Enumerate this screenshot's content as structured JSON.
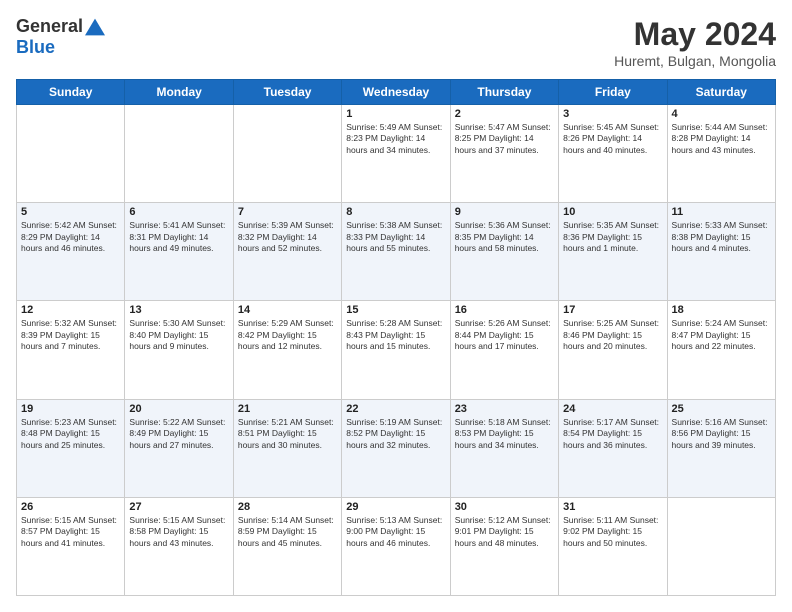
{
  "header": {
    "logo_line1": "General",
    "logo_line2": "Blue",
    "month": "May 2024",
    "location": "Huremt, Bulgan, Mongolia"
  },
  "days_of_week": [
    "Sunday",
    "Monday",
    "Tuesday",
    "Wednesday",
    "Thursday",
    "Friday",
    "Saturday"
  ],
  "weeks": [
    [
      {
        "day": "",
        "text": ""
      },
      {
        "day": "",
        "text": ""
      },
      {
        "day": "",
        "text": ""
      },
      {
        "day": "1",
        "text": "Sunrise: 5:49 AM\nSunset: 8:23 PM\nDaylight: 14 hours\nand 34 minutes."
      },
      {
        "day": "2",
        "text": "Sunrise: 5:47 AM\nSunset: 8:25 PM\nDaylight: 14 hours\nand 37 minutes."
      },
      {
        "day": "3",
        "text": "Sunrise: 5:45 AM\nSunset: 8:26 PM\nDaylight: 14 hours\nand 40 minutes."
      },
      {
        "day": "4",
        "text": "Sunrise: 5:44 AM\nSunset: 8:28 PM\nDaylight: 14 hours\nand 43 minutes."
      }
    ],
    [
      {
        "day": "5",
        "text": "Sunrise: 5:42 AM\nSunset: 8:29 PM\nDaylight: 14 hours\nand 46 minutes."
      },
      {
        "day": "6",
        "text": "Sunrise: 5:41 AM\nSunset: 8:31 PM\nDaylight: 14 hours\nand 49 minutes."
      },
      {
        "day": "7",
        "text": "Sunrise: 5:39 AM\nSunset: 8:32 PM\nDaylight: 14 hours\nand 52 minutes."
      },
      {
        "day": "8",
        "text": "Sunrise: 5:38 AM\nSunset: 8:33 PM\nDaylight: 14 hours\nand 55 minutes."
      },
      {
        "day": "9",
        "text": "Sunrise: 5:36 AM\nSunset: 8:35 PM\nDaylight: 14 hours\nand 58 minutes."
      },
      {
        "day": "10",
        "text": "Sunrise: 5:35 AM\nSunset: 8:36 PM\nDaylight: 15 hours\nand 1 minute."
      },
      {
        "day": "11",
        "text": "Sunrise: 5:33 AM\nSunset: 8:38 PM\nDaylight: 15 hours\nand 4 minutes."
      }
    ],
    [
      {
        "day": "12",
        "text": "Sunrise: 5:32 AM\nSunset: 8:39 PM\nDaylight: 15 hours\nand 7 minutes."
      },
      {
        "day": "13",
        "text": "Sunrise: 5:30 AM\nSunset: 8:40 PM\nDaylight: 15 hours\nand 9 minutes."
      },
      {
        "day": "14",
        "text": "Sunrise: 5:29 AM\nSunset: 8:42 PM\nDaylight: 15 hours\nand 12 minutes."
      },
      {
        "day": "15",
        "text": "Sunrise: 5:28 AM\nSunset: 8:43 PM\nDaylight: 15 hours\nand 15 minutes."
      },
      {
        "day": "16",
        "text": "Sunrise: 5:26 AM\nSunset: 8:44 PM\nDaylight: 15 hours\nand 17 minutes."
      },
      {
        "day": "17",
        "text": "Sunrise: 5:25 AM\nSunset: 8:46 PM\nDaylight: 15 hours\nand 20 minutes."
      },
      {
        "day": "18",
        "text": "Sunrise: 5:24 AM\nSunset: 8:47 PM\nDaylight: 15 hours\nand 22 minutes."
      }
    ],
    [
      {
        "day": "19",
        "text": "Sunrise: 5:23 AM\nSunset: 8:48 PM\nDaylight: 15 hours\nand 25 minutes."
      },
      {
        "day": "20",
        "text": "Sunrise: 5:22 AM\nSunset: 8:49 PM\nDaylight: 15 hours\nand 27 minutes."
      },
      {
        "day": "21",
        "text": "Sunrise: 5:21 AM\nSunset: 8:51 PM\nDaylight: 15 hours\nand 30 minutes."
      },
      {
        "day": "22",
        "text": "Sunrise: 5:19 AM\nSunset: 8:52 PM\nDaylight: 15 hours\nand 32 minutes."
      },
      {
        "day": "23",
        "text": "Sunrise: 5:18 AM\nSunset: 8:53 PM\nDaylight: 15 hours\nand 34 minutes."
      },
      {
        "day": "24",
        "text": "Sunrise: 5:17 AM\nSunset: 8:54 PM\nDaylight: 15 hours\nand 36 minutes."
      },
      {
        "day": "25",
        "text": "Sunrise: 5:16 AM\nSunset: 8:56 PM\nDaylight: 15 hours\nand 39 minutes."
      }
    ],
    [
      {
        "day": "26",
        "text": "Sunrise: 5:15 AM\nSunset: 8:57 PM\nDaylight: 15 hours\nand 41 minutes."
      },
      {
        "day": "27",
        "text": "Sunrise: 5:15 AM\nSunset: 8:58 PM\nDaylight: 15 hours\nand 43 minutes."
      },
      {
        "day": "28",
        "text": "Sunrise: 5:14 AM\nSunset: 8:59 PM\nDaylight: 15 hours\nand 45 minutes."
      },
      {
        "day": "29",
        "text": "Sunrise: 5:13 AM\nSunset: 9:00 PM\nDaylight: 15 hours\nand 46 minutes."
      },
      {
        "day": "30",
        "text": "Sunrise: 5:12 AM\nSunset: 9:01 PM\nDaylight: 15 hours\nand 48 minutes."
      },
      {
        "day": "31",
        "text": "Sunrise: 5:11 AM\nSunset: 9:02 PM\nDaylight: 15 hours\nand 50 minutes."
      },
      {
        "day": "",
        "text": ""
      }
    ]
  ]
}
